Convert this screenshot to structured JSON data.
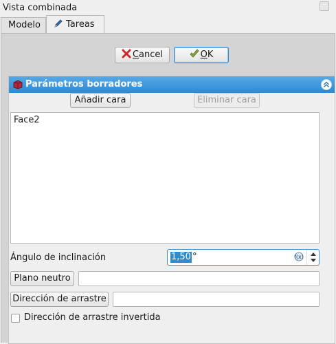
{
  "window": {
    "title": "Vista combinada"
  },
  "tabs": [
    {
      "label": "Modelo"
    },
    {
      "label": "Tareas"
    }
  ],
  "dialog": {
    "cancel_pre": "",
    "cancel_mnemonic": "C",
    "cancel_rest": "ancel",
    "ok_mnemonic": "O",
    "ok_rest": "K"
  },
  "panel": {
    "title": "Parámetros borradores",
    "add_face": "Añadir cara",
    "remove_face": "Eliminar cara",
    "faces": [
      "Face2"
    ],
    "angle_label": "Ángulo de inclinación",
    "angle_value": "1,50",
    "angle_unit": "°",
    "neutral_plane_button": "Plano neutro",
    "neutral_plane_value": "",
    "pull_direction_button": "Dirección de arrastre",
    "pull_direction_value": "",
    "reverse_label": "Dirección de arrastre invertida",
    "reverse_checked": false
  },
  "colors": {
    "header_blue": "#2d8ad3",
    "selection": "#308cc6",
    "cancel_icon_red": "#cc2a2a",
    "ok_icon_green": "#6c8c2c"
  },
  "icons": {
    "tab_tareas": "pencil-icon",
    "cancel": "cancel-x-icon",
    "ok": "ok-check-icon",
    "panel_header": "draft-feature-icon",
    "collapse": "collapse-icon",
    "expression": "expression-icon"
  }
}
